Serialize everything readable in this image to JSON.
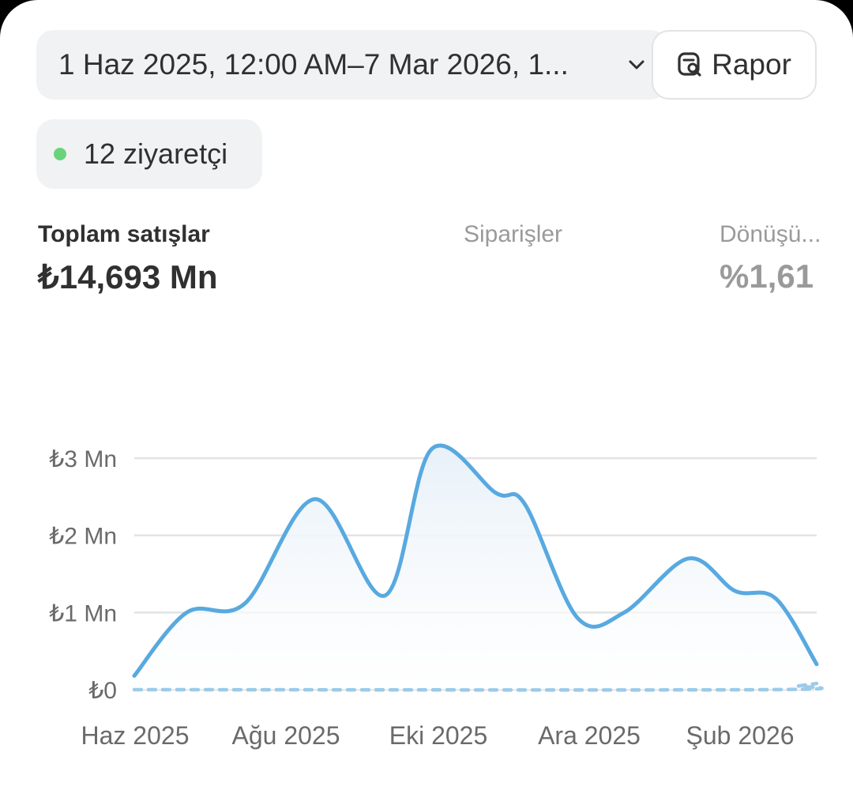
{
  "header": {
    "date_range": "1 Haz 2025, 12:00 AM–7 Mar 2026, 1...",
    "report_label": "Rapor"
  },
  "visitors": {
    "label": "12 ziyaretçi",
    "status_color": "#6ad37a"
  },
  "metrics": [
    {
      "label": "Toplam satışlar",
      "value": "₺14,693 Mn"
    },
    {
      "label": "Siparişler",
      "value": ""
    },
    {
      "label": "Dönüşü...",
      "value": "%1,61"
    }
  ],
  "chart_data": {
    "type": "area",
    "title": "",
    "ylabel": "",
    "xlabel": "",
    "ylim": [
      0,
      3
    ],
    "yticks": [
      0,
      1,
      2,
      3
    ],
    "ytick_labels": [
      "₺0",
      "₺1 Mn",
      "₺2 Mn",
      "₺3 Mn"
    ],
    "xtick_labels": [
      "Haz 2025",
      "Ağu 2025",
      "Eki 2025",
      "Ara 2025",
      "Şub 2026"
    ],
    "grid": true,
    "series": [
      {
        "style": "solid",
        "color": "#58a9e0",
        "x": [
          0,
          0.9,
          1.9,
          3.1,
          4.3,
          5.1,
          6.2,
          6.7,
          7.6,
          8.4,
          9.5,
          10.3,
          11.0,
          11.7
        ],
        "values": [
          0.18,
          1.0,
          1.12,
          2.47,
          1.22,
          3.12,
          2.55,
          2.4,
          0.93,
          1.0,
          1.7,
          1.28,
          1.18,
          0.33
        ]
      },
      {
        "style": "dashed",
        "color": "#9ccbe9",
        "x": [
          0,
          10.8,
          11.4,
          11.7
        ],
        "values": [
          0,
          0,
          0.05,
          0.08
        ]
      }
    ]
  }
}
